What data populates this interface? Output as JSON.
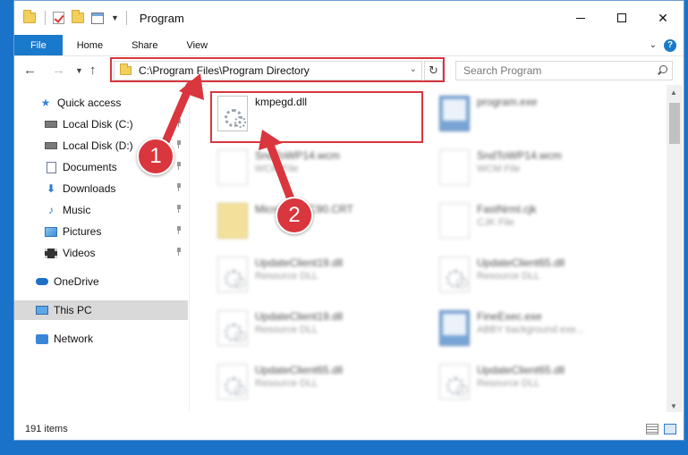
{
  "window": {
    "title": "Program"
  },
  "ribbon": {
    "tabs": [
      "File",
      "Home",
      "Share",
      "View"
    ],
    "help_label": "?"
  },
  "address": {
    "path": "C:\\Program Files\\Program Directory",
    "search_placeholder": "Search Program"
  },
  "sidebar": {
    "items": [
      {
        "label": "Quick access",
        "icon": "star-icon"
      },
      {
        "label": "Local Disk (C:)",
        "icon": "drive-icon"
      },
      {
        "label": "Local Disk (D:)",
        "icon": "drive-icon"
      },
      {
        "label": "Documents",
        "icon": "documents-icon"
      },
      {
        "label": "Downloads",
        "icon": "downloads-icon"
      },
      {
        "label": "Music",
        "icon": "music-icon"
      },
      {
        "label": "Pictures",
        "icon": "pictures-icon"
      },
      {
        "label": "Videos",
        "icon": "videos-icon"
      },
      {
        "label": "OneDrive",
        "icon": "onedrive-icon"
      },
      {
        "label": "This PC",
        "icon": "computer-icon"
      },
      {
        "label": "Network",
        "icon": "network-icon"
      }
    ]
  },
  "files": [
    {
      "name": "kmpegd.dll",
      "type": "",
      "icon": "dll"
    },
    {
      "name": "program.exe",
      "type": "",
      "icon": "exe"
    },
    {
      "name": "SndToWP14.wcm",
      "type": "WCM File",
      "icon": "doc"
    },
    {
      "name": "SndToWP14.wcm",
      "type": "WCM File",
      "icon": "doc"
    },
    {
      "name": "Microsoft.VC90.CRT",
      "type": "",
      "icon": "crt"
    },
    {
      "name": "FastNrml.cjk",
      "type": "CJK File",
      "icon": "doc"
    },
    {
      "name": "UpdateClient19.dll",
      "type": "Resource DLL",
      "icon": "dll"
    },
    {
      "name": "UpdateClient65.dll",
      "type": "Resource DLL",
      "icon": "dll"
    },
    {
      "name": "UpdateClient19.dll",
      "type": "Resource DLL",
      "icon": "dll"
    },
    {
      "name": "FineExec.exe",
      "type": "ABBY background exe...",
      "icon": "exe"
    },
    {
      "name": "UpdateClient65.dll",
      "type": "Resource DLL",
      "icon": "dll"
    },
    {
      "name": "UpdateClient65.dll",
      "type": "Resource DLL",
      "icon": "dll"
    }
  ],
  "status": {
    "item_count": "191 items"
  },
  "annotations": {
    "step1": "1",
    "step2": "2"
  },
  "colors": {
    "accent": "#1979ca",
    "highlight": "#d9363e",
    "desktop": "#1a73c8"
  }
}
